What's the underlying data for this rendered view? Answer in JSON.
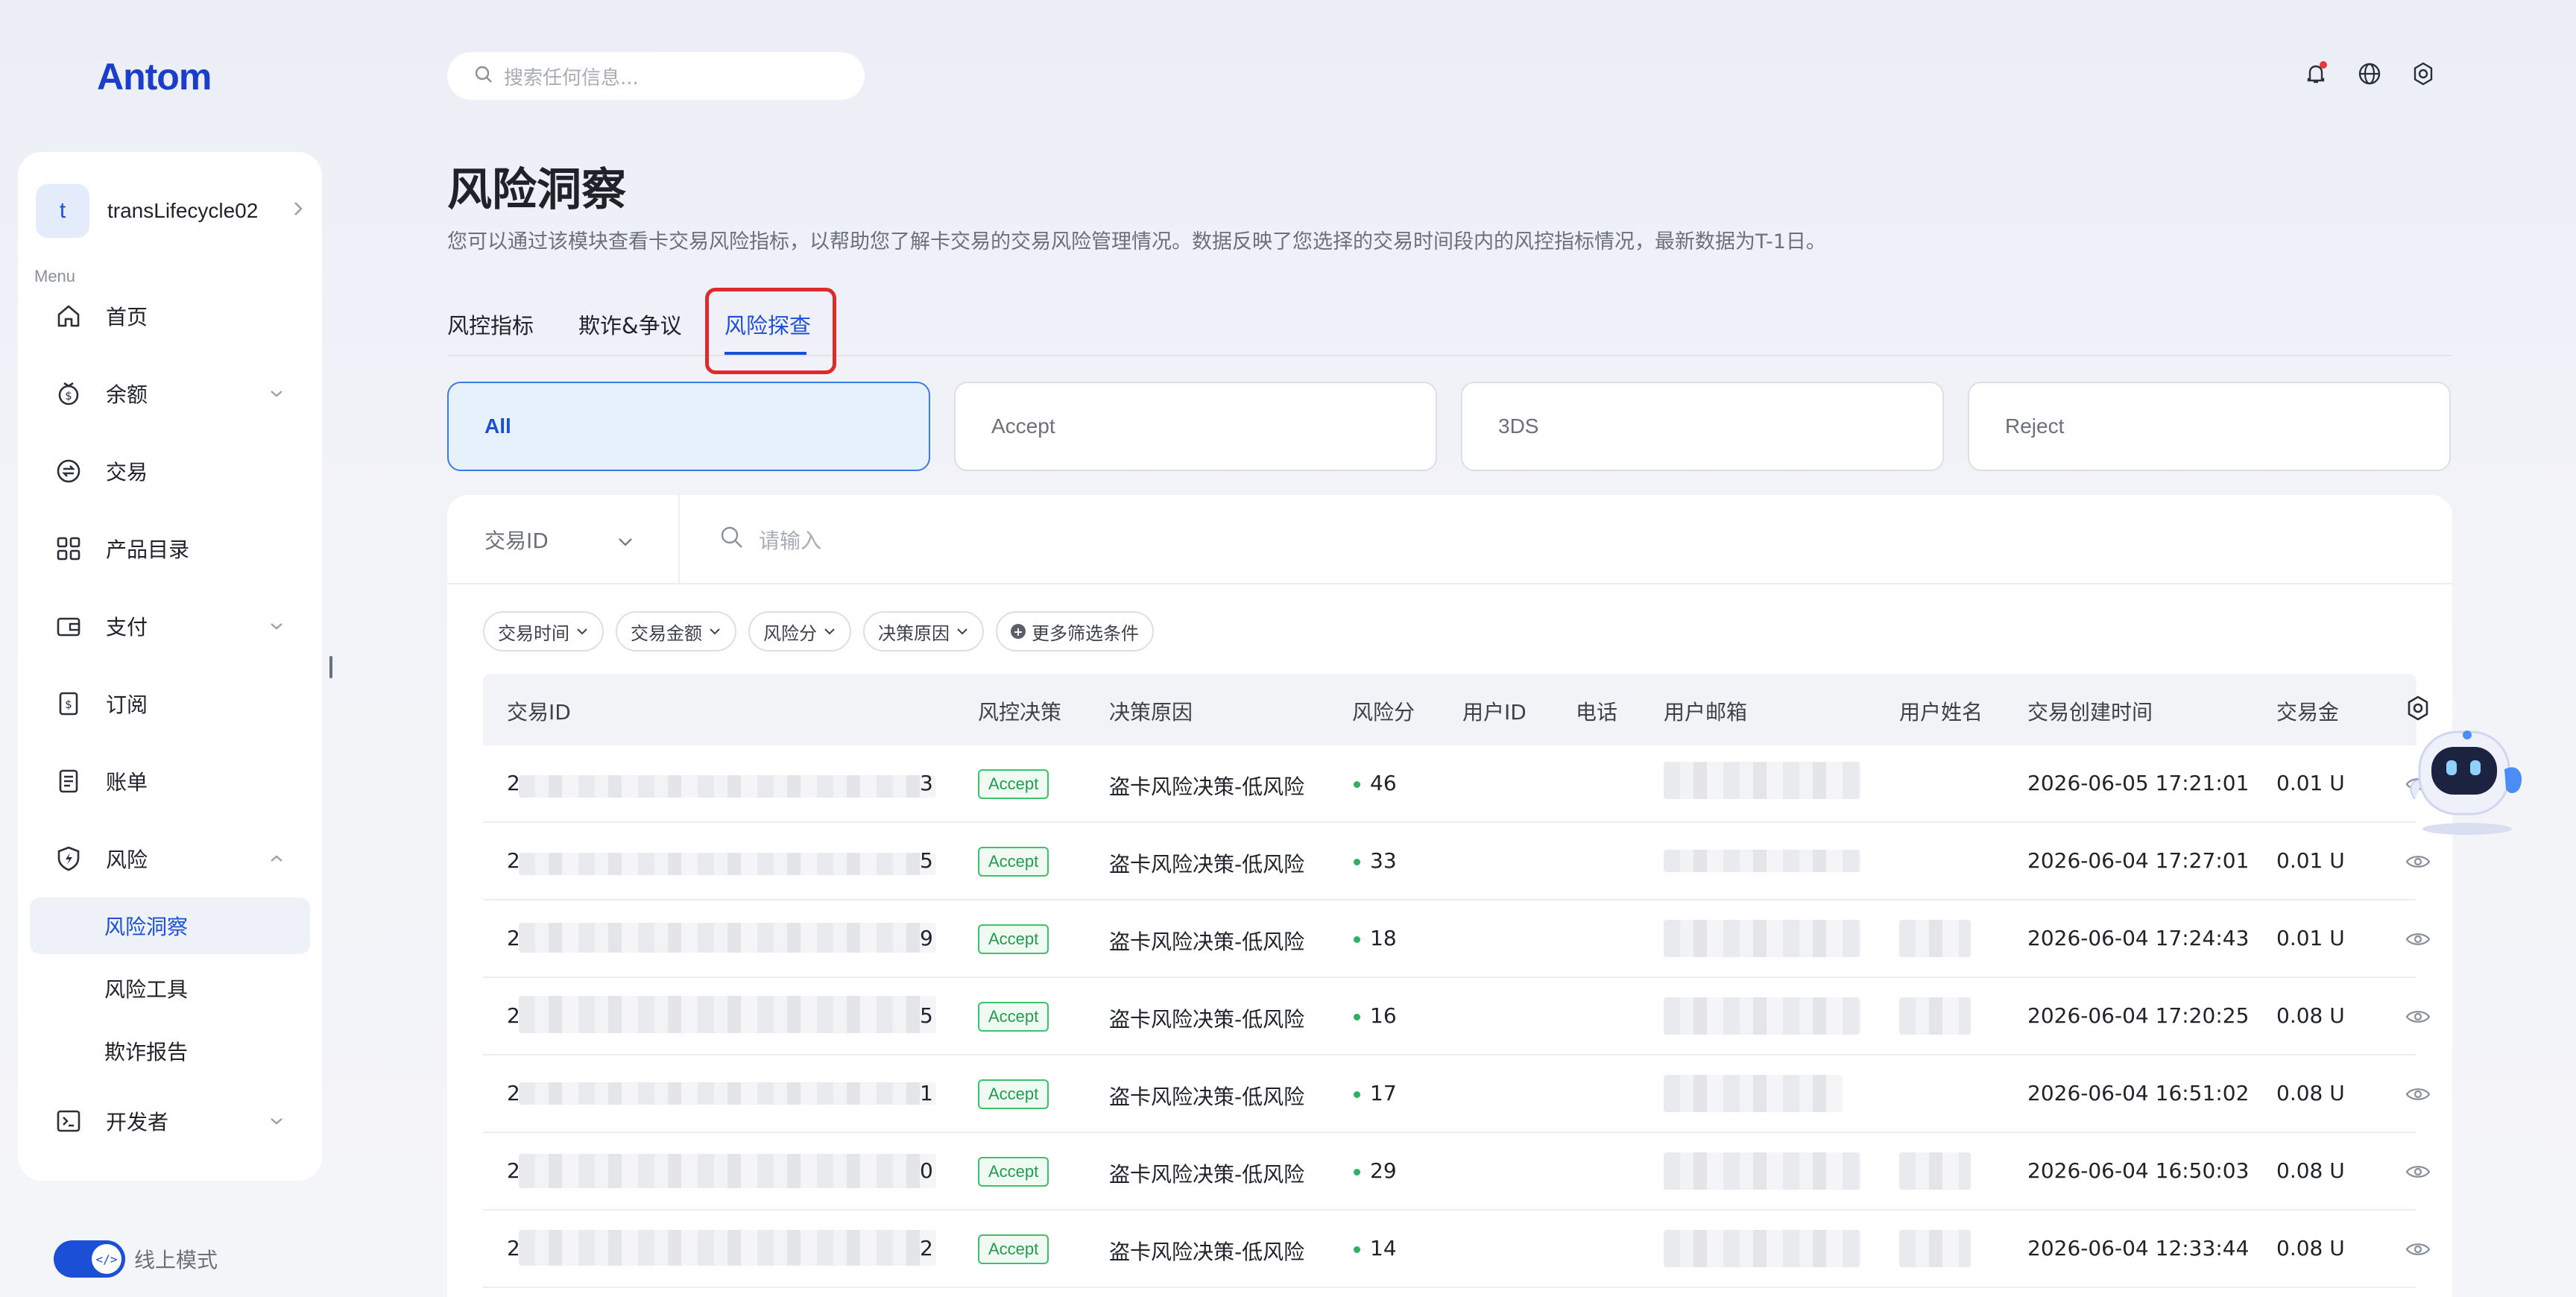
{
  "brand": {
    "logo": "Antom",
    "accent": "#1a4fd6"
  },
  "account": {
    "initial": "t",
    "name": "transLifecycle02"
  },
  "sidebar": {
    "menu_label": "Menu",
    "items": [
      {
        "label": "首页",
        "icon": "home-icon"
      },
      {
        "label": "余额",
        "icon": "balance-icon"
      },
      {
        "label": "交易",
        "icon": "transactions-icon"
      },
      {
        "label": "产品目录",
        "icon": "catalog-icon"
      },
      {
        "label": "支付",
        "icon": "wallet-icon"
      },
      {
        "label": "订阅",
        "icon": "subscription-icon"
      },
      {
        "label": "账单",
        "icon": "bill-icon"
      },
      {
        "label": "风险",
        "icon": "shield-icon"
      },
      {
        "label": "开发者",
        "icon": "terminal-icon"
      }
    ],
    "risk_sub": [
      "风险洞察",
      "风险工具",
      "欺诈报告"
    ],
    "mode_label": "线上模式"
  },
  "search": {
    "placeholder": "搜索任何信息..."
  },
  "page": {
    "title": "风险洞察",
    "description": "您可以通过该模块查看卡交易风险指标，以帮助您了解卡交易的交易风险管理情况。数据反映了您选择的交易时间段内的风控指标情况，最新数据为T-1日。"
  },
  "tabs": [
    "风控指标",
    "欺诈&争议",
    "风险探查"
  ],
  "decision_filters": [
    "All",
    "Accept",
    "3DS",
    "Reject"
  ],
  "query": {
    "field": "交易ID",
    "placeholder": "请输入"
  },
  "chips": [
    "交易时间",
    "交易金额",
    "风险分",
    "决策原因",
    "更多筛选条件"
  ],
  "table": {
    "headers": [
      "交易ID",
      "风控决策",
      "决策原因",
      "风险分",
      "用户ID",
      "电话",
      "用户邮箱",
      "用户姓名",
      "交易创建时间",
      "交易金"
    ],
    "rows": [
      {
        "id_start": "2",
        "id_end": "3",
        "decision": "Accept",
        "reason": "盗卡风险决策-低风险",
        "score": "46",
        "created": "2026-06-05 17:21:01",
        "amount": "0.01 U"
      },
      {
        "id_start": "2",
        "id_end": "5",
        "decision": "Accept",
        "reason": "盗卡风险决策-低风险",
        "score": "33",
        "created": "2026-06-04 17:27:01",
        "amount": "0.01 U"
      },
      {
        "id_start": "2",
        "id_end": "9",
        "decision": "Accept",
        "reason": "盗卡风险决策-低风险",
        "score": "18",
        "created": "2026-06-04 17:24:43",
        "amount": "0.01 U"
      },
      {
        "id_start": "2",
        "id_end": "5",
        "decision": "Accept",
        "reason": "盗卡风险决策-低风险",
        "score": "16",
        "created": "2026-06-04 17:20:25",
        "amount": "0.08 U"
      },
      {
        "id_start": "2",
        "id_end": "1",
        "decision": "Accept",
        "reason": "盗卡风险决策-低风险",
        "score": "17",
        "created": "2026-06-04 16:51:02",
        "amount": "0.08 U"
      },
      {
        "id_start": "2",
        "id_end": "0",
        "decision": "Accept",
        "reason": "盗卡风险决策-低风险",
        "score": "29",
        "created": "2026-06-04 16:50:03",
        "amount": "0.08 U"
      },
      {
        "id_start": "2",
        "id_end": "2",
        "decision": "Accept",
        "reason": "盗卡风险决策-低风险",
        "score": "14",
        "created": "2026-06-04 12:33:44",
        "amount": "0.08 U"
      }
    ]
  }
}
